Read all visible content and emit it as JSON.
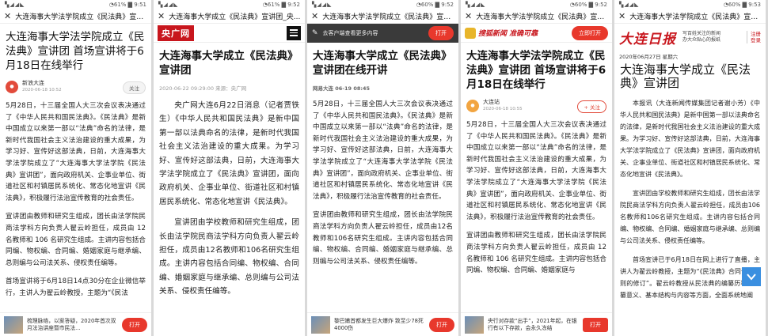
{
  "status": {
    "left": "▚◢◢◣",
    "right_1": "◔61% ▇ 9:51",
    "right_2": "◔61% ▇ 9:52",
    "right_3": "◔60% ▇ 9:52",
    "right_4": "◔60% ▇ 9:52",
    "right_5": "◔60% ▇ 9:53"
  },
  "p1": {
    "title_bar": "大连海事大学法学院成立《民法典》宣讲团",
    "headline": "大连海事大学法学院成立《民法典》宣讲团 首场宣讲将于6月18日在线举行",
    "author": "新浪大连",
    "date": "2020-06-18 10:52",
    "follow": "关注",
    "para1": "5月28日，十三届全国人大三次会议表决通过了《中华人民共和国民法典》。《民法典》是新中国成立以来第一部以“法典”命名的法律，是新时代我国社会主义法治建设的重大成果，为学习好、宣传好这部法典，日前，大连海事大学法学院成立了“大连海事大学法学院《民法典》宣讲团”，面向政府机关、企事业单位、街道社区和村镇居民系统化、常态化地宣讲《民法典》，积极履行法治宣传教育的社会责任。",
    "para2": "宣讲团由教师和研究生组成，团长由法学院民商法学科方向负责人翟云岭担任，成员由 12 名教师和 106 名研究生组成。主讲内容包括合同编、物权编、合同编、婚姻家庭与继承编、总则编与公司法关系、侵权责任编等。",
    "para3": "首场宣讲将于6月18日14点30分在企业微信举行，主讲人为翟云岭教授，主题为“《民法",
    "bottom_text": "梳理脉络，以案答疑，2020年首次双月法治讲座暨市民法...",
    "open": "打开"
  },
  "p2": {
    "title_bar": "大连海事大学成立《民法典》宣讲团_央...",
    "logo": "央广网",
    "headline": "大连海事大学成立《民法典》宣讲团",
    "meta": "2020-06-22 09:29:00   来源：央广网",
    "para1": "央广网大连6月22日消息（记者贾铁生）《中华人民共和国民法典》是新中国第一部以法典命名的法律，是新时代我国社会主义法治建设的重大成果。为学习好、宣传好这部法典，日前，大连海事大学法学院成立了《民法典》宣讲团，面向政府机关、企事业单位、街道社区和村镇居民系统化、常态化地宣讲《民法典》。",
    "para2": "宣讲团由学校教师和研究生组成，团长由法学院民商法学科方向负责人翟云岭担任，成员由12名教师和106名研究生组成。主讲内容包括合同编、物权编、合同编、婚姻家庭与继承编、总则编与公司法关系、侵权责任编等。"
  },
  "p3": {
    "title_bar": "大连海事大学法学院成立《民法典》宣讲团...",
    "dark_text": "去客户端查看更多内容",
    "open": "打开",
    "headline": "大连海事大学成立《民法典》宣讲团在线开讲",
    "meta": "网易大连   06-19 08:45",
    "para1": "5月28日，十三届全国人大三次会议表决通过了《中华人民共和国民法典》。《民法典》是新中国成立以来第一部以“法典”命名的法律，是新时代我国社会主义法治建设的重大成果，为学习好、宣传好这部法典，日前，大连海事大学法学院成立了“大连海事大学法学院《民法典》宣讲团”，面向政府机关、企事业单位、街道社区和村镇居民系统化、常态化地宣讲《民法典》，积极履行法治宣传教育的社会责任。",
    "para2": "宣讲团由教师和研究生组成，团长由法学院民商法学科方向负责人翟云岭担任，成员由12名教师和106名研究生组成。主讲内容包括合同编、物权编、合同编、婚姻家庭与继承编、总则编与公司法关系、侵权责任编等。",
    "bottom_text": "黎巴嫩首都发生巨大爆炸 致至少78死4000伤",
    "bottom_open": "打开"
  },
  "p4": {
    "title_bar": "大连海事大学法学院成立《民法典》宣讲团...",
    "logo": "搜狐新闻 准确可靠",
    "open": "立即打开",
    "headline": "大连海事大学法学院成立《民法典》宣讲团 首场宣讲将于6月18日在线举行",
    "author": "大连站",
    "date": "2020-06-18 10:55",
    "follow": "+ 关注",
    "para1": "5月28日，十三届全国人大三次会议表决通过了《中华人民共和国民法典》。《民法典》是新中国成立以来第一部以“法典”命名的法律，是新时代我国社会主义法治建设的重大成果，为学习好、宣传好这部法典，日前，大连海事大学法学院成立了“大连海事大学法学院《民法典》宣讲团”，面向政府机关、企事业单位、街道社区和村镇居民系统化、常态化地宣讲《民法典》，积极履行法治宣传教育的社会责任。",
    "para2": "宣讲团由教师和研究生组成，团长由法学院民商法学科方向负责人翟云岭担任，成员由 12 名教师和 106 名研究生组成。主讲内容包括合同编、物权编、合同编、婚姻家庭与",
    "bottom_text": "央行对存款“出手”，2021年起，在银行有以下存款，会永久冻结",
    "bottom_open": "打开"
  },
  "p5": {
    "title_bar": "大连海事大学法学院成立《民法典》宣讲团_第A...",
    "logo": "大连日报",
    "slogan_1": "写百姓关注的新闻",
    "slogan_2": "办大众贴心的报纸",
    "login_1": "注册",
    "login_2": "登录",
    "date": "2020年06月27日 星期六",
    "headline": "大连海事大学成立《民法典》宣讲团",
    "para1": "本报讯（大连新闻传媒集团记者谢小芳）《中华人民共和国民法典》是新中国第一部以法典命名的法律，是新时代我国社会主义法治建设的重大成果。为学习好、宣传好这部法典，日前，大连海事大学法学院成立了《民法典》宣讲团，面向政府机关、企事业单位、街道社区和村镇居民系统化、常态化地宣讲《民法典》。",
    "para2": "宣讲团由学校教师和研究生组成，团长由法学院民商法学科方向负责人翟云岭担任，成员由106名教师和106名研究生组成。主讲内容包括合同编、物权编、合同编、婚姻家庭与继承编、总则编与公司法关系、侵权责任编等。",
    "para3": "首场宣讲已于6月18日在网上进行了直播，主讲人为翟云岭教授，主题为“《民法典》合同订立规则的修订”。翟云岭教授从民法典的编纂历程、编纂意义、基本结构与内容等方面，全面系统地阐"
  }
}
